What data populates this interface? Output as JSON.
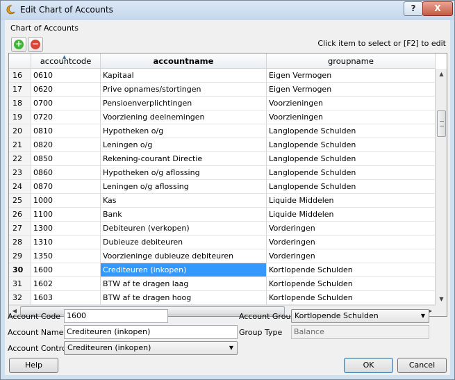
{
  "window": {
    "title": "Edit Chart of Accounts",
    "help_label": "?",
    "close_label": "X"
  },
  "group": {
    "label": "Chart of Accounts",
    "hint": "Click item to select or [F2] to edit"
  },
  "toolbar": {
    "add_symbol": "+",
    "remove_symbol": "−",
    "add_color": "#3db536",
    "remove_color": "#d9453b"
  },
  "table": {
    "columns": [
      "accountcode",
      "accountname",
      "groupname"
    ],
    "rows": [
      {
        "n": "16",
        "code": "0610",
        "name": "Kapitaal",
        "group": "Eigen Vermogen"
      },
      {
        "n": "17",
        "code": "0620",
        "name": "Prive opnames/stortingen",
        "group": "Eigen Vermogen"
      },
      {
        "n": "18",
        "code": "0700",
        "name": "Pensioenverplichtingen",
        "group": "Voorzieningen"
      },
      {
        "n": "19",
        "code": "0720",
        "name": "Voorziening deelnemingen",
        "group": "Voorzieningen"
      },
      {
        "n": "20",
        "code": "0810",
        "name": "Hypotheken o/g",
        "group": "Langlopende Schulden"
      },
      {
        "n": "21",
        "code": "0820",
        "name": "Leningen o/g",
        "group": "Langlopende Schulden"
      },
      {
        "n": "22",
        "code": "0850",
        "name": "Rekening-courant Directie",
        "group": "Langlopende Schulden"
      },
      {
        "n": "23",
        "code": "0860",
        "name": "Hypotheken o/g aflossing",
        "group": "Langlopende Schulden"
      },
      {
        "n": "24",
        "code": "0870",
        "name": "Leningen o/g aflossing",
        "group": "Langlopende Schulden"
      },
      {
        "n": "25",
        "code": "1000",
        "name": "Kas",
        "group": "Liquide Middelen"
      },
      {
        "n": "26",
        "code": "1100",
        "name": "Bank",
        "group": "Liquide Middelen"
      },
      {
        "n": "27",
        "code": "1300",
        "name": "Debiteuren (verkopen)",
        "group": "Vorderingen"
      },
      {
        "n": "28",
        "code": "1310",
        "name": "Dubieuze debiteuren",
        "group": "Vorderingen"
      },
      {
        "n": "29",
        "code": "1350",
        "name": "Voorzieninge dubieuze debiteuren",
        "group": "Vorderingen"
      },
      {
        "n": "30",
        "code": "1600",
        "name": "Crediteuren (inkopen)",
        "group": "Kortlopende Schulden",
        "selected": true
      },
      {
        "n": "31",
        "code": "1602",
        "name": "BTW af te dragen laag",
        "group": "Kortlopende Schulden"
      },
      {
        "n": "32",
        "code": "1603",
        "name": "BTW af te dragen hoog",
        "group": "Kortlopende Schulden"
      }
    ],
    "selection_color": "#3399ff"
  },
  "form": {
    "account_code_label": "Account Code",
    "account_code_value": "1600",
    "account_name_label": "Account Name",
    "account_name_value": "Crediteuren (inkopen)",
    "account_control_label": "Account Control",
    "account_control_value": "Crediteuren (inkopen)",
    "account_group_label": "Account Group",
    "account_group_value": "Kortlopende Schulden",
    "group_type_label": "Group Type",
    "group_type_value": "Balance"
  },
  "buttons": {
    "help": "Help",
    "ok": "OK",
    "cancel": "Cancel"
  }
}
